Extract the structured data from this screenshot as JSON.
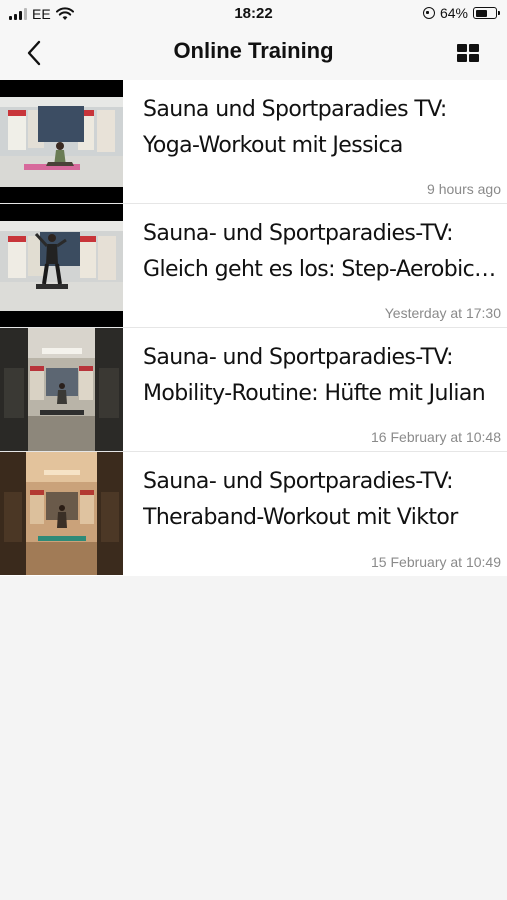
{
  "status_bar": {
    "carrier": "EE",
    "time": "18:22",
    "battery_percent": "64%",
    "battery_level": 0.64
  },
  "nav": {
    "title": "Online Training",
    "back_icon": "chevron-left-icon",
    "view_toggle_icon": "grid-view-icon"
  },
  "videos": [
    {
      "title_line1": "Sauna und Sportparadies TV:",
      "title_line2": "Yoga-Workout mit Jessica",
      "time": "9 hours ago"
    },
    {
      "title_line1": "Sauna- und Sportparadies-TV:",
      "title_line2": "Gleich geht es los: Step-Aerobic…",
      "time": "Yesterday at 17:30"
    },
    {
      "title_line1": "Sauna- und Sportparadies-TV:",
      "title_line2": "Mobility-Routine: Hüfte mit Julian",
      "time": "16 February at 10:48"
    },
    {
      "title_line1": "Sauna- und Sportparadies-TV:",
      "title_line2": "Theraband-Workout mit Viktor",
      "time": "15 February at 10:49"
    }
  ]
}
